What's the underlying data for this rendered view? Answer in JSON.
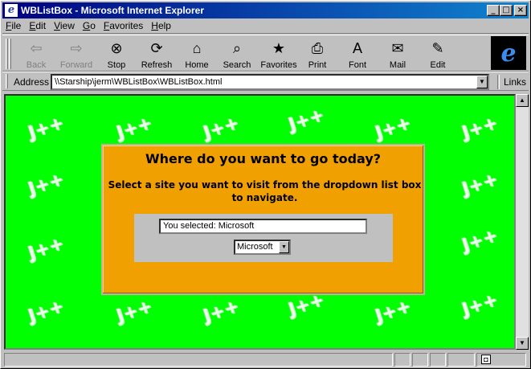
{
  "window": {
    "title": "WBListBox - Microsoft Internet Explorer",
    "icon": "ie-icon",
    "controls": [
      "_",
      "□",
      "×"
    ]
  },
  "menu": [
    {
      "first": "F",
      "rest": "ile"
    },
    {
      "first": "E",
      "rest": "dit"
    },
    {
      "first": "V",
      "rest": "iew"
    },
    {
      "first": "G",
      "rest": "o"
    },
    {
      "first": "F",
      "rest": "avorites"
    },
    {
      "first": "H",
      "rest": "elp"
    }
  ],
  "toolbar": {
    "back": {
      "label": "Back",
      "icon": "back-arrow-icon",
      "glyph": "⇦"
    },
    "forward": {
      "label": "Forward",
      "icon": "forward-arrow-icon",
      "glyph": "⇨"
    },
    "stop": {
      "label": "Stop",
      "icon": "stop-icon",
      "glyph": "⊗"
    },
    "refresh": {
      "label": "Refresh",
      "icon": "refresh-icon",
      "glyph": "⟳"
    },
    "home": {
      "label": "Home",
      "icon": "home-icon",
      "glyph": "⌂"
    },
    "search": {
      "label": "Search",
      "icon": "search-icon",
      "glyph": "⌕"
    },
    "favorites": {
      "label": "Favorites",
      "icon": "favorites-folder-icon",
      "glyph": "★"
    },
    "print": {
      "label": "Print",
      "icon": "printer-icon",
      "glyph": "⎙"
    },
    "font": {
      "label": "Font",
      "icon": "font-icon",
      "glyph": "A"
    },
    "mail": {
      "label": "Mail",
      "icon": "mail-icon",
      "glyph": "✉"
    },
    "edit": {
      "label": "Edit",
      "icon": "edit-icon",
      "glyph": "✎"
    },
    "logo": "e"
  },
  "address": {
    "label": "Address",
    "value": "\\\\Starship\\jerm\\WBListBox\\WBListBox.html",
    "links": "Links"
  },
  "page": {
    "background_color": "#00ff00",
    "watermark": "J++",
    "heading": "Where do you want to go today?",
    "instructions": "Select a site you want to visit from the dropdown list box to navigate.",
    "selection_text": "You selected: Microsoft",
    "dropdown_value": "Microsoft",
    "panel_color": "#f0a000"
  },
  "scrollbar": {
    "up": "▲",
    "down": "▼"
  }
}
